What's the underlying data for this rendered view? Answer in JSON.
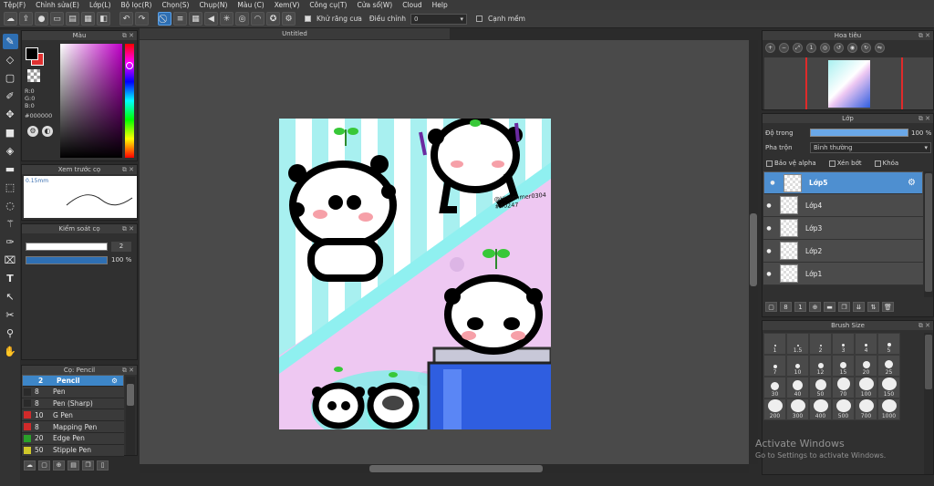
{
  "menu": [
    "Tệp(F)",
    "Chỉnh sửa(E)",
    "Lớp(L)",
    "Bộ lọc(R)",
    "Chọn(S)",
    "Chụp(N)",
    "Màu (C)",
    "Xem(V)",
    "Công cụ(T)",
    "Cửa sổ(W)",
    "Cloud",
    "Help"
  ],
  "toolbar": {
    "antialias_label": "Khử răng cưa",
    "adjust_label": "Điều chỉnh",
    "adjust_value": "0",
    "edge_label": "Cạnh mềm"
  },
  "color_panel": {
    "title": "Màu",
    "r": "R:0",
    "g": "G:0",
    "b": "B:0",
    "hex": "#000000",
    "fg_color": "#000000",
    "bg_color": "#e03030"
  },
  "preview_panel": {
    "title": "Xem trước cọ",
    "size": "0.15mm"
  },
  "brush_control": {
    "title": "Kiểm soát cọ",
    "size_value": "2",
    "opacity_value": "100 %"
  },
  "brush_list": {
    "title": "Cọ: Pencil",
    "items": [
      {
        "size": "2",
        "name": "Pencil",
        "color": "#3d86c8",
        "selected": true
      },
      {
        "size": "8",
        "name": "Pen",
        "color": "#2a2a2a",
        "selected": false
      },
      {
        "size": "8",
        "name": "Pen (Sharp)",
        "color": "#2a2a2a",
        "selected": false
      },
      {
        "size": "10",
        "name": "G Pen",
        "color": "#d02a2a",
        "selected": false
      },
      {
        "size": "8",
        "name": "Mapping Pen",
        "color": "#d02a2a",
        "selected": false
      },
      {
        "size": "20",
        "name": "Edge Pen",
        "color": "#2aa02a",
        "selected": false
      },
      {
        "size": "50",
        "name": "Stipple Pen",
        "color": "#d0c82a",
        "selected": false
      }
    ]
  },
  "canvas": {
    "tab_title": "Untitled",
    "watermark_handle": "@HiSummer0304",
    "watermark_tag": "#40247"
  },
  "navigator": {
    "title": "Hoa tiêu"
  },
  "layer_panel": {
    "title": "Lớp",
    "opacity_label": "Độ trong",
    "opacity_value": "100 %",
    "blend_label": "Pha trộn",
    "blend_value": "Bình thường",
    "protect_alpha": "Bảo vệ alpha",
    "clipping": "Xén bớt",
    "lock": "Khóa",
    "layers": [
      {
        "name": "Lớp5",
        "selected": true
      },
      {
        "name": "Lớp4",
        "selected": false
      },
      {
        "name": "Lớp3",
        "selected": false
      },
      {
        "name": "Lớp2",
        "selected": false
      },
      {
        "name": "Lớp1",
        "selected": false
      }
    ]
  },
  "brush_size": {
    "title": "Brush Size",
    "sizes": [
      "1",
      "1.5",
      "2",
      "3",
      "4",
      "5",
      "7",
      "10",
      "12",
      "15",
      "20",
      "25",
      "30",
      "40",
      "50",
      "70",
      "100",
      "150",
      "200",
      "300",
      "400",
      "500",
      "700",
      "1000"
    ]
  },
  "activation": {
    "line1": "Activate Windows",
    "line2": "Go to Settings to activate Windows."
  }
}
